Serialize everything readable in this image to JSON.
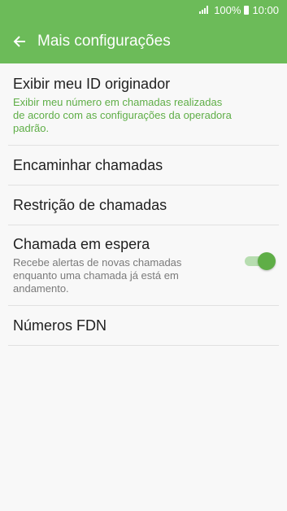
{
  "status": {
    "battery": "100%",
    "time": "10:00"
  },
  "header": {
    "title": "Mais configurações",
    "back_icon": "arrow-left"
  },
  "items": [
    {
      "title": "Exibir meu ID originador",
      "subtitle": "Exibir meu número em chamadas realizadas de acordo com as configurações da operadora padrão."
    },
    {
      "title": "Encaminhar chamadas"
    },
    {
      "title": "Restrição de chamadas"
    },
    {
      "title": "Chamada em espera",
      "subtitle": "Recebe alertas de novas chamadas enquanto uma chamada já está em andamento.",
      "toggle_on": true
    },
    {
      "title": "Números FDN"
    }
  ],
  "colors": {
    "accent": "#6cbb59",
    "toggle_on": "#5fae47"
  }
}
